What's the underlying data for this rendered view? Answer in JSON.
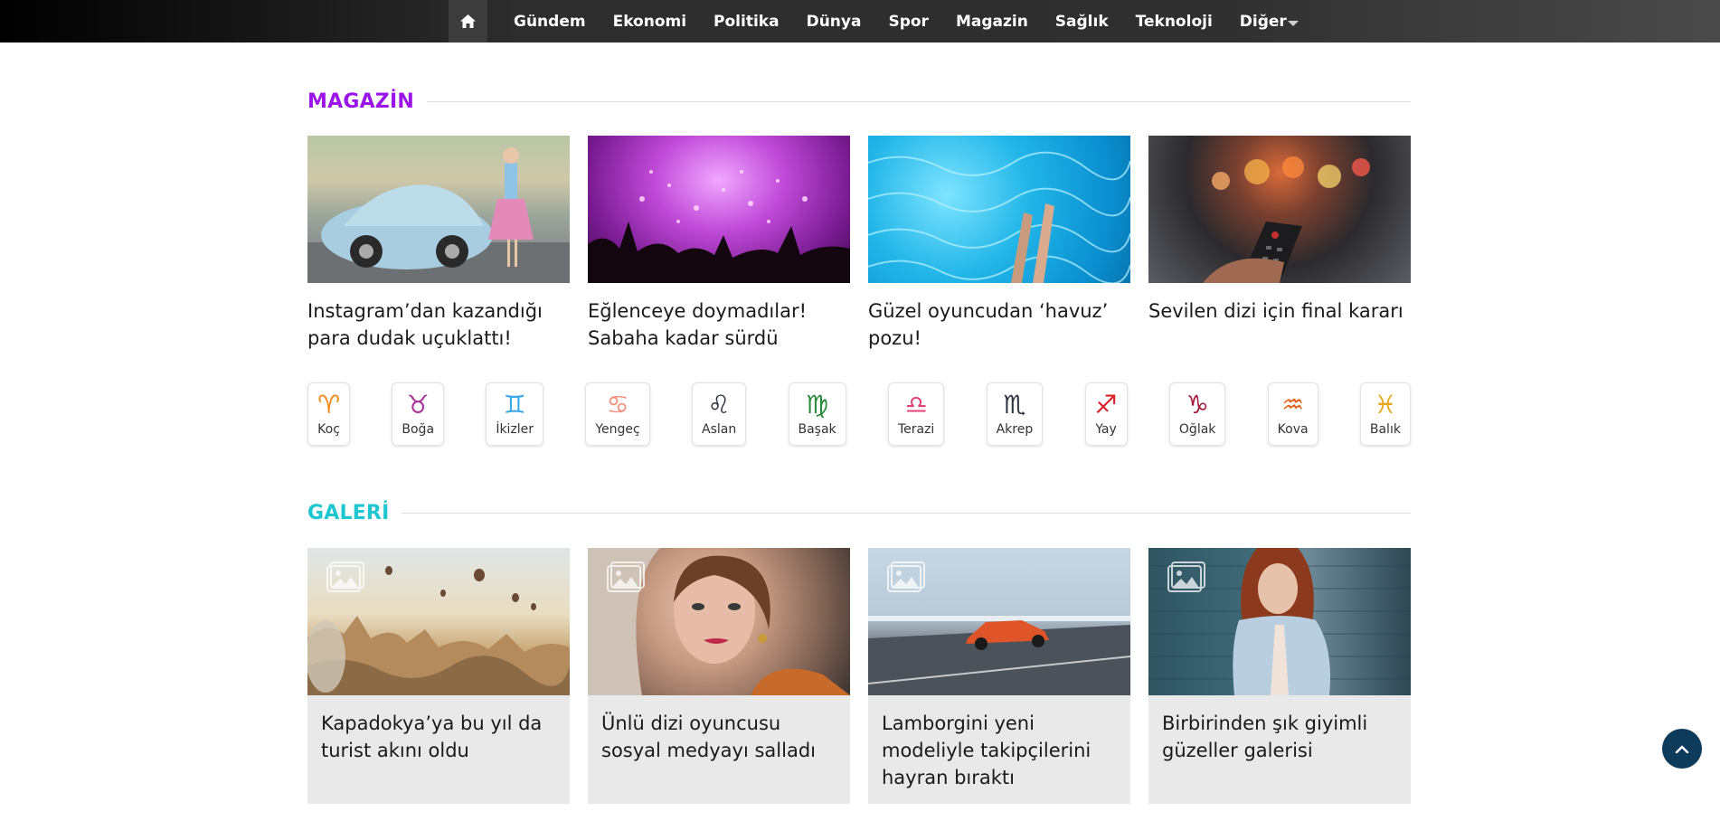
{
  "nav": {
    "home_icon": "home-icon",
    "items": [
      "Gündem",
      "Ekonomi",
      "Politika",
      "Dünya",
      "Spor",
      "Magazin",
      "Sağlık",
      "Teknoloji",
      "Diğer"
    ]
  },
  "magazin": {
    "title": "MAGAZİN",
    "title_color": "#9b14ea",
    "cards": [
      {
        "headline": "Instagram’dan kazandığı para dudak uçuklattı!"
      },
      {
        "headline": "Eğlenceye doymadılar! Sabaha kadar sürdü"
      },
      {
        "headline": "Güzel oyuncudan ‘havuz’ pozu!"
      },
      {
        "headline": "Sevilen dizi için final kararı"
      }
    ]
  },
  "horoscope": [
    {
      "label": "Koç",
      "glyph": "♈",
      "color": "#f08a1c"
    },
    {
      "label": "Boğa",
      "glyph": "♉",
      "color": "#a8359c"
    },
    {
      "label": "İkizler",
      "glyph": "♊",
      "color": "#3aa7e8"
    },
    {
      "label": "Yengeç",
      "glyph": "♋",
      "color": "#f0907a"
    },
    {
      "label": "Aslan",
      "glyph": "♌",
      "color": "#2d3440"
    },
    {
      "label": "Başak",
      "glyph": "♍",
      "color": "#2a8a3a"
    },
    {
      "label": "Terazi",
      "glyph": "♎",
      "color": "#e0457a"
    },
    {
      "label": "Akrep",
      "glyph": "♏",
      "color": "#2d3440"
    },
    {
      "label": "Yay",
      "glyph": "♐",
      "color": "#d81f2a"
    },
    {
      "label": "Oğlak",
      "glyph": "♑",
      "color": "#a0183a"
    },
    {
      "label": "Kova",
      "glyph": "♒",
      "color": "#e2641c"
    },
    {
      "label": "Balık",
      "glyph": "♓",
      "color": "#e8a81c"
    }
  ],
  "galeri": {
    "title": "GALERİ",
    "title_color": "#1ec7cf",
    "gallery_icon": "gallery-icon",
    "cards": [
      {
        "headline": "Kapadokya’ya bu yıl da turist akını oldu"
      },
      {
        "headline": "Ünlü dizi oyuncusu sosyal medyayı salladı"
      },
      {
        "headline": "Lamborgini yeni modeliyle takipçilerini hayran bıraktı"
      },
      {
        "headline": "Birbirinden şık giyimli güzeller galerisi"
      }
    ]
  },
  "back_to_top_icon": "chevron-up-icon"
}
